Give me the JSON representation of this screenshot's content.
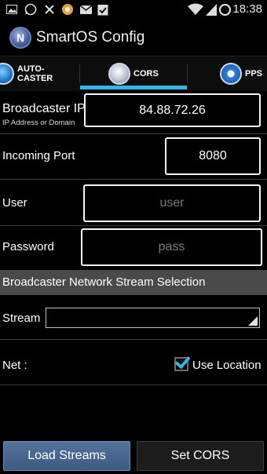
{
  "status_bar": {
    "time": "18:38",
    "left_icons": [
      "image-icon",
      "whatsapp-icon",
      "usb-icon",
      "app-icon",
      "mail-icon",
      "clipboard-check-icon"
    ],
    "right_icons": [
      "wifi-icon",
      "signal-icon",
      "sync-icon"
    ]
  },
  "app": {
    "title": "SmartOS Config",
    "logo_letter": "N"
  },
  "tabs": [
    {
      "label_line1": "AUTO-",
      "label_line2": "CASTER",
      "icon": "autocaster-icon"
    },
    {
      "label_line1": "CORS",
      "label_line2": "",
      "icon": "cors-globe-icon",
      "selected": true
    },
    {
      "label_line1": "PPS",
      "label_line2": "",
      "icon": "pps-icon"
    }
  ],
  "form": {
    "broadcaster_ip": {
      "label": "Broadcaster IP",
      "sublabel": "IP Address or Domain",
      "value": "84.88.72.26"
    },
    "incoming_port": {
      "label": "Incoming Port",
      "value": "8080"
    },
    "user": {
      "label": "User",
      "placeholder": "user",
      "value": ""
    },
    "password": {
      "label": "Password",
      "placeholder": "pass",
      "value": ""
    }
  },
  "section": {
    "title": "Broadcaster Network Stream Selection"
  },
  "stream": {
    "label": "Stream",
    "selected": ""
  },
  "net": {
    "label": "Net :",
    "use_location_label": "Use Location",
    "use_location_checked": true
  },
  "buttons": {
    "load_streams": "Load Streams",
    "set_cors": "Set CORS"
  },
  "colors": {
    "accent": "#33b5e5",
    "section_bg": "#4a4a4a",
    "primary_button": "#3c5a85"
  }
}
